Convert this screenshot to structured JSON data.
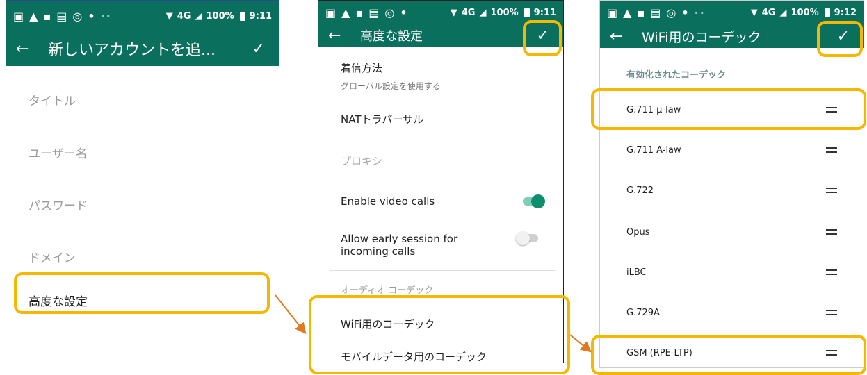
{
  "status": {
    "time1": "9:11",
    "time2": "9:11",
    "time3": "9:12",
    "network": "4G",
    "battery": "100%"
  },
  "screen1": {
    "title": "新しいアカウントを追...",
    "fields": [
      "タイトル",
      "ユーザー名",
      "パスワード",
      "ドメイン"
    ],
    "advanced": "高度な設定"
  },
  "screen2": {
    "title": "高度な設定",
    "incoming_method": "着信方法",
    "incoming_method_sub": "グローバル設定を使用する",
    "nat": "NATトラバーサル",
    "proxy": "プロキシ",
    "enable_video": "Enable video calls",
    "enable_video_on": true,
    "allow_early_line1": "Allow early session for",
    "allow_early_line2": "incoming calls",
    "allow_early_on": false,
    "audio_codec_header": "オーディオ コーデック",
    "wifi_codec": "WiFi用のコーデック",
    "mobile_codec": "モバイルデータ用のコーデック"
  },
  "screen3": {
    "title": "WiFi用のコーデック",
    "enabled_header": "有効化されたコーデック",
    "codecs": [
      "G.711 µ-law",
      "G.711 A-law",
      "G.722",
      "Opus",
      "iLBC",
      "G.729A",
      "GSM (RPE-LTP)"
    ]
  },
  "colors": {
    "appbar": "#0b6f5e",
    "highlight": "#f5b800",
    "arrow": "#e07a1e",
    "toggle_on": "#0b8f6e"
  }
}
